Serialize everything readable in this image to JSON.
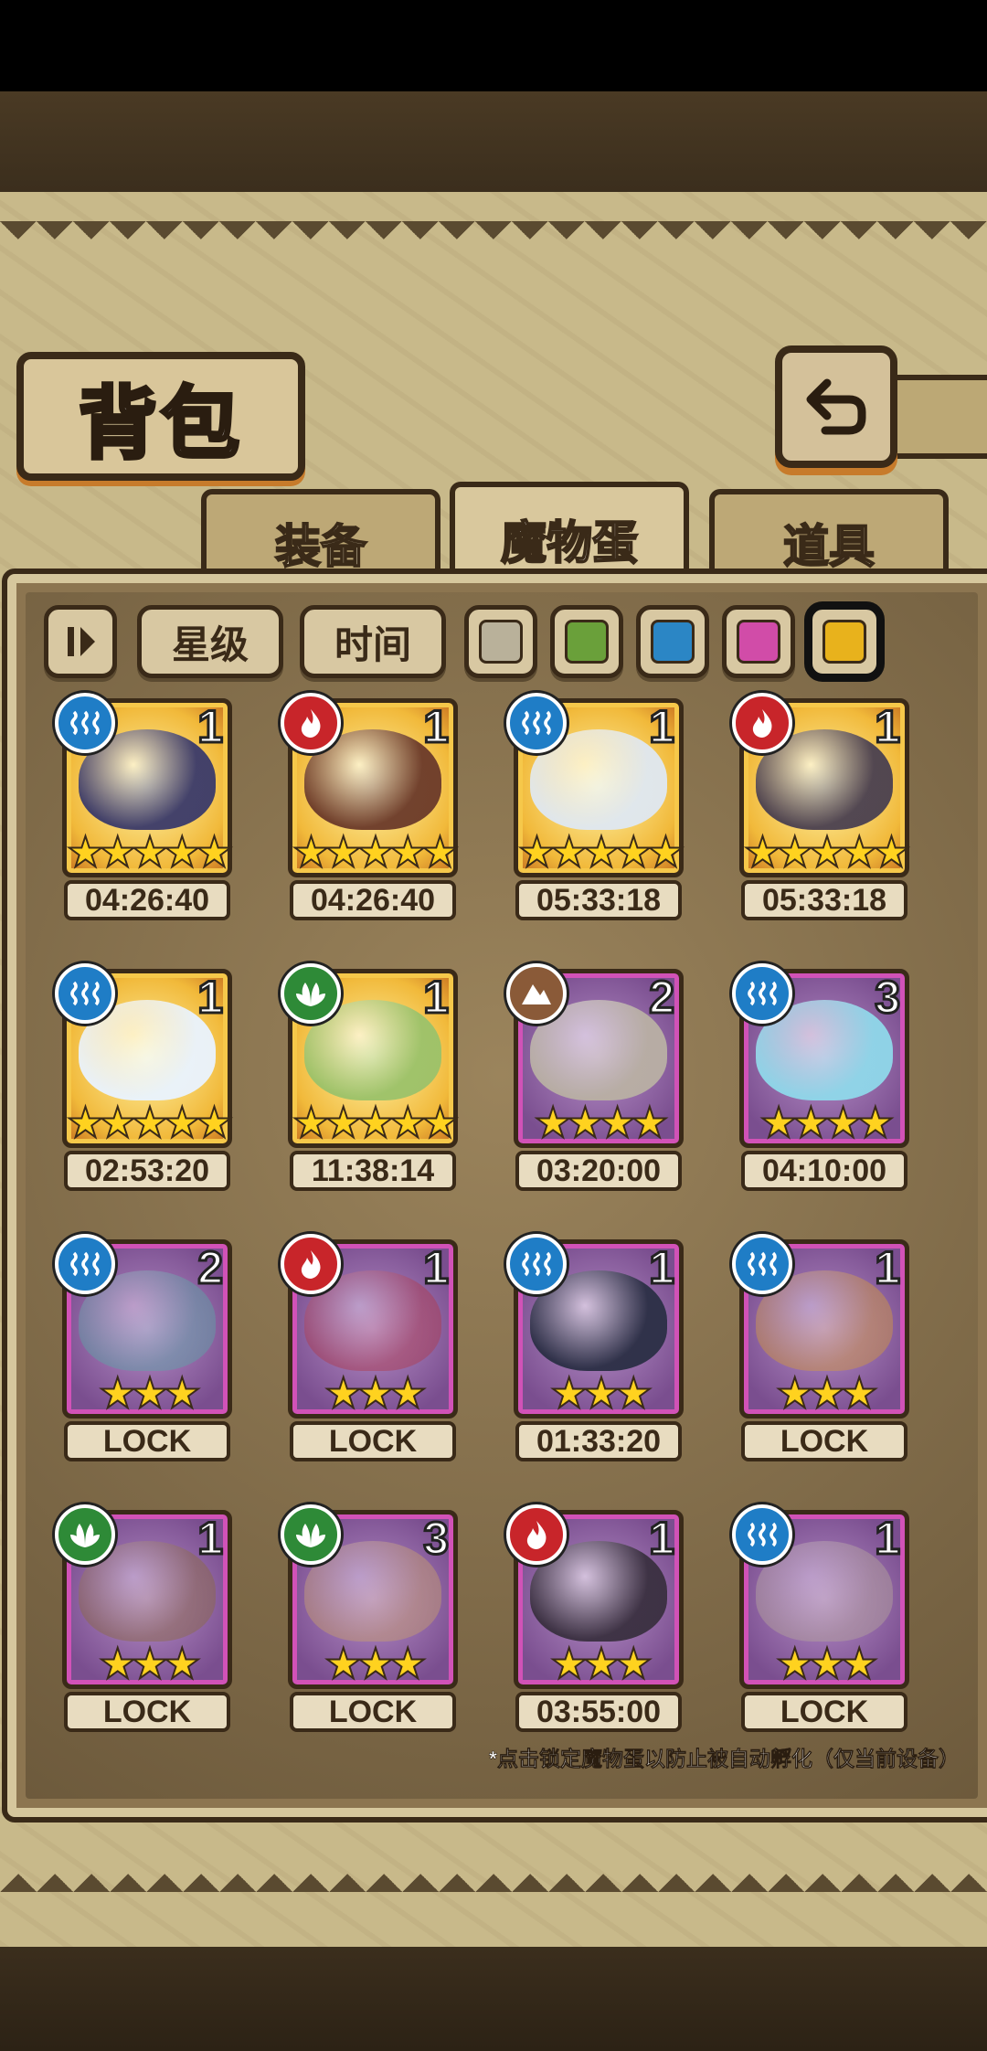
{
  "title": "背包",
  "tabs": [
    {
      "label": "装备",
      "active": false
    },
    {
      "label": "魔物蛋",
      "active": true
    },
    {
      "label": "道具",
      "active": false
    }
  ],
  "filters": {
    "sort_star": "星级",
    "sort_time": "时间",
    "colors": [
      "#b9b19a",
      "#6aa03a",
      "#2b86c5",
      "#d14ca8",
      "#e8b21c"
    ],
    "selected_color_index": 4
  },
  "element_colors": {
    "water": "#1f7dc6",
    "fire": "#c8252a",
    "grass": "#2e8a37",
    "earth": "#8a5a38"
  },
  "eggs": [
    {
      "element": "water-icon",
      "count": "1",
      "stars": "★★★★★",
      "rarity": "gold",
      "label": "04:26:40",
      "locked": false,
      "art": "#3a3a6a"
    },
    {
      "element": "fire-icon",
      "count": "1",
      "stars": "★★★★★",
      "rarity": "gold",
      "label": "04:26:40",
      "locked": false,
      "art": "#6b3a2a"
    },
    {
      "element": "water-icon",
      "count": "1",
      "stars": "★★★★★",
      "rarity": "gold",
      "label": "05:33:18",
      "locked": false,
      "art": "#dfe8f2"
    },
    {
      "element": "fire-icon",
      "count": "1",
      "stars": "★★★★★",
      "rarity": "gold",
      "label": "05:33:18",
      "locked": false,
      "art": "#4a4050"
    },
    {
      "element": "water-icon",
      "count": "1",
      "stars": "★★★★★",
      "rarity": "gold",
      "label": "02:53:20",
      "locked": false,
      "art": "#e9f3ff"
    },
    {
      "element": "grass-icon",
      "count": "1",
      "stars": "★★★★★",
      "rarity": "gold",
      "label": "11:38:14",
      "locked": false,
      "art": "#9bc26a"
    },
    {
      "element": "earth-icon",
      "count": "2",
      "stars": "★★★★",
      "rarity": "purple",
      "label": "03:20:00",
      "locked": false,
      "art": "#b9b0a4"
    },
    {
      "element": "water-icon",
      "count": "3",
      "stars": "★★★★",
      "rarity": "purple",
      "label": "04:10:00",
      "locked": false,
      "art": "#8fd8ea"
    },
    {
      "element": "water-icon",
      "count": "2",
      "stars": "★★★",
      "rarity": "purple",
      "label": "LOCK",
      "locked": true,
      "art": "#5aa7a6"
    },
    {
      "element": "fire-icon",
      "count": "1",
      "stars": "★★★",
      "rarity": "purple",
      "label": "LOCK",
      "locked": true,
      "art": "#b0394a"
    },
    {
      "element": "water-icon",
      "count": "1",
      "stars": "★★★",
      "rarity": "purple",
      "label": "01:33:20",
      "locked": false,
      "art": "#2b2f45"
    },
    {
      "element": "water-icon",
      "count": "1",
      "stars": "★★★",
      "rarity": "purple",
      "label": "LOCK",
      "locked": true,
      "art": "#d49a3a"
    },
    {
      "element": "grass-icon",
      "count": "1",
      "stars": "★★★",
      "rarity": "purple",
      "label": "LOCK",
      "locked": true,
      "art": "#8b6a3f"
    },
    {
      "element": "grass-icon",
      "count": "3",
      "stars": "★★★",
      "rarity": "purple",
      "label": "LOCK",
      "locked": true,
      "art": "#c9a06a"
    },
    {
      "element": "fire-icon",
      "count": "1",
      "stars": "★★★",
      "rarity": "purple",
      "label": "03:55:00",
      "locked": false,
      "art": "#3a3040"
    },
    {
      "element": "water-icon",
      "count": "1",
      "stars": "★★★",
      "rarity": "purple",
      "label": "LOCK",
      "locked": true,
      "art": "#b5a69a"
    }
  ],
  "footnote": "*点击锁定魔物蛋以防止被自动孵化（仅当前设备）"
}
